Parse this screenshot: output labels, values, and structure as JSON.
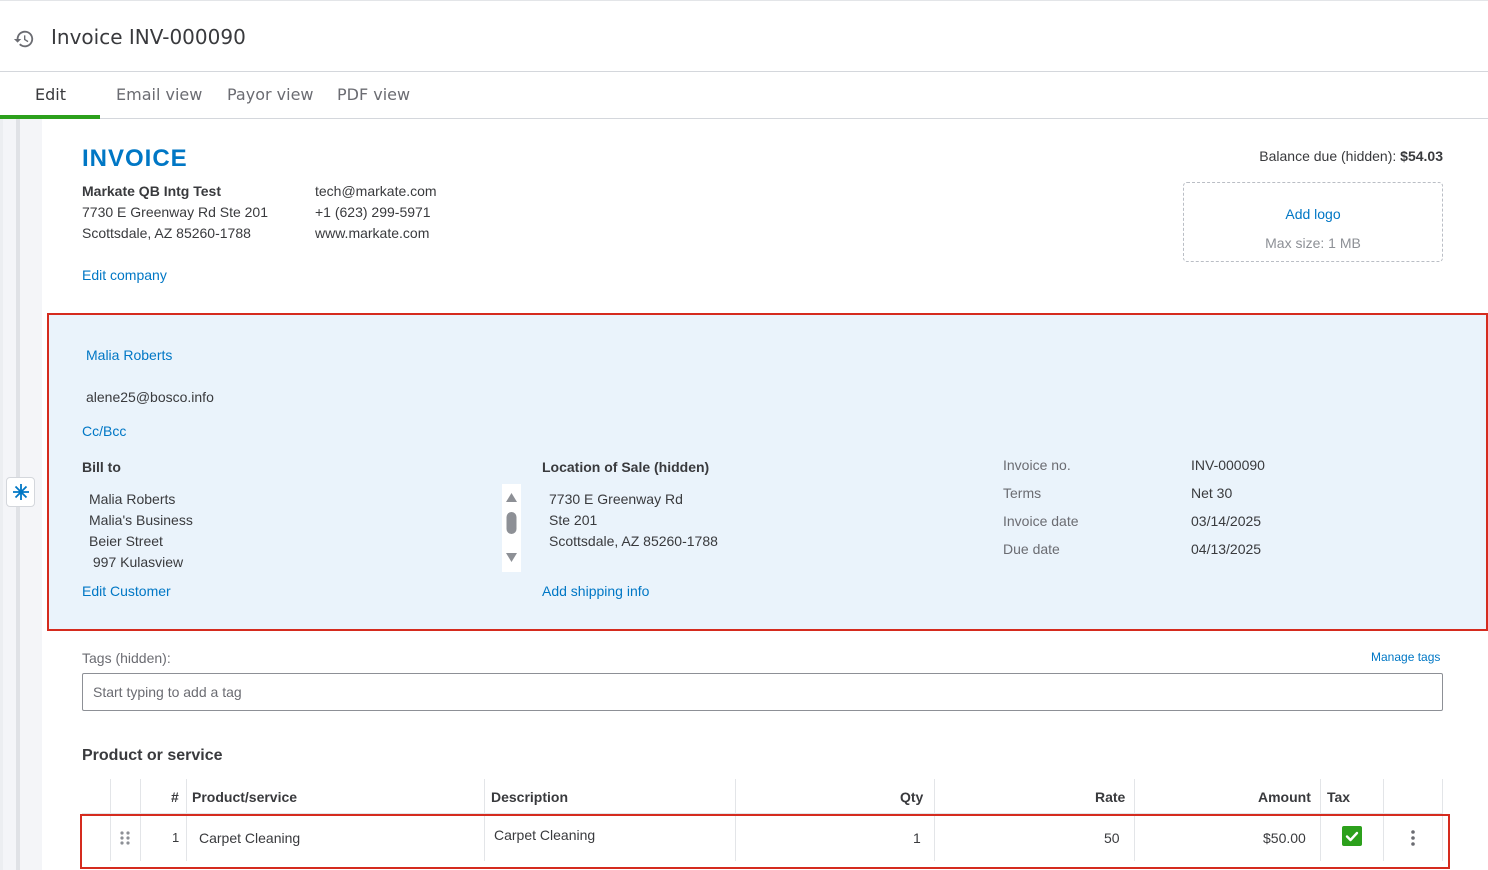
{
  "header": {
    "title": "Invoice INV-000090",
    "history_icon": "history-icon"
  },
  "tabs": [
    {
      "label": "Edit",
      "active": true
    },
    {
      "label": "Email view"
    },
    {
      "label": "Payor view"
    },
    {
      "label": "PDF view"
    }
  ],
  "invoice": {
    "heading": "INVOICE",
    "balance_label": "Balance due (hidden):",
    "balance_value": "$54.03",
    "company": {
      "name": "Markate QB Intg Test",
      "address1": "7730 E Greenway Rd Ste 201",
      "address2": "Scottsdale, AZ 85260-1788",
      "email": "tech@markate.com",
      "phone": "+1 (623) 299-5971",
      "website": "www.markate.com",
      "edit_link": "Edit company"
    },
    "logo": {
      "add_label": "Add logo",
      "max_size": "Max size: 1 MB"
    }
  },
  "customer": {
    "name": "Malia Roberts",
    "email": "alene25@bosco.info",
    "cc_bcc": "Cc/Bcc",
    "bill_to_label": "Bill to",
    "bill_to": [
      "Malia Roberts",
      "Malia's Business",
      "Beier Street",
      " 997 Kulasview"
    ],
    "edit_customer": "Edit Customer",
    "location_label": "Location of Sale (hidden)",
    "location": [
      "7730 E Greenway Rd",
      "Ste 201",
      "Scottsdale, AZ 85260-1788"
    ],
    "add_shipping": "Add shipping info",
    "meta": [
      {
        "label": "Invoice no.",
        "value": "INV-000090"
      },
      {
        "label": "Terms",
        "value": "Net 30"
      },
      {
        "label": "Invoice date",
        "value": "03/14/2025"
      },
      {
        "label": "Due date",
        "value": "04/13/2025"
      }
    ]
  },
  "tags": {
    "label": "Tags (hidden):",
    "manage_link": "Manage tags",
    "placeholder": "Start typing to add a tag"
  },
  "products": {
    "section_title": "Product or service",
    "columns": {
      "num": "#",
      "product": "Product/service",
      "description": "Description",
      "qty": "Qty",
      "rate": "Rate",
      "amount": "Amount",
      "tax": "Tax"
    },
    "rows": [
      {
        "num": "1",
        "product": "Carpet Cleaning",
        "description": "Carpet Cleaning",
        "qty": "1",
        "rate": "50",
        "amount": "$50.00",
        "tax_checked": true
      }
    ]
  },
  "colors": {
    "brand_blue": "#0077c5",
    "green": "#2ca01c",
    "highlight_red": "#d52b1e",
    "customer_bg": "#eaf3fb"
  }
}
